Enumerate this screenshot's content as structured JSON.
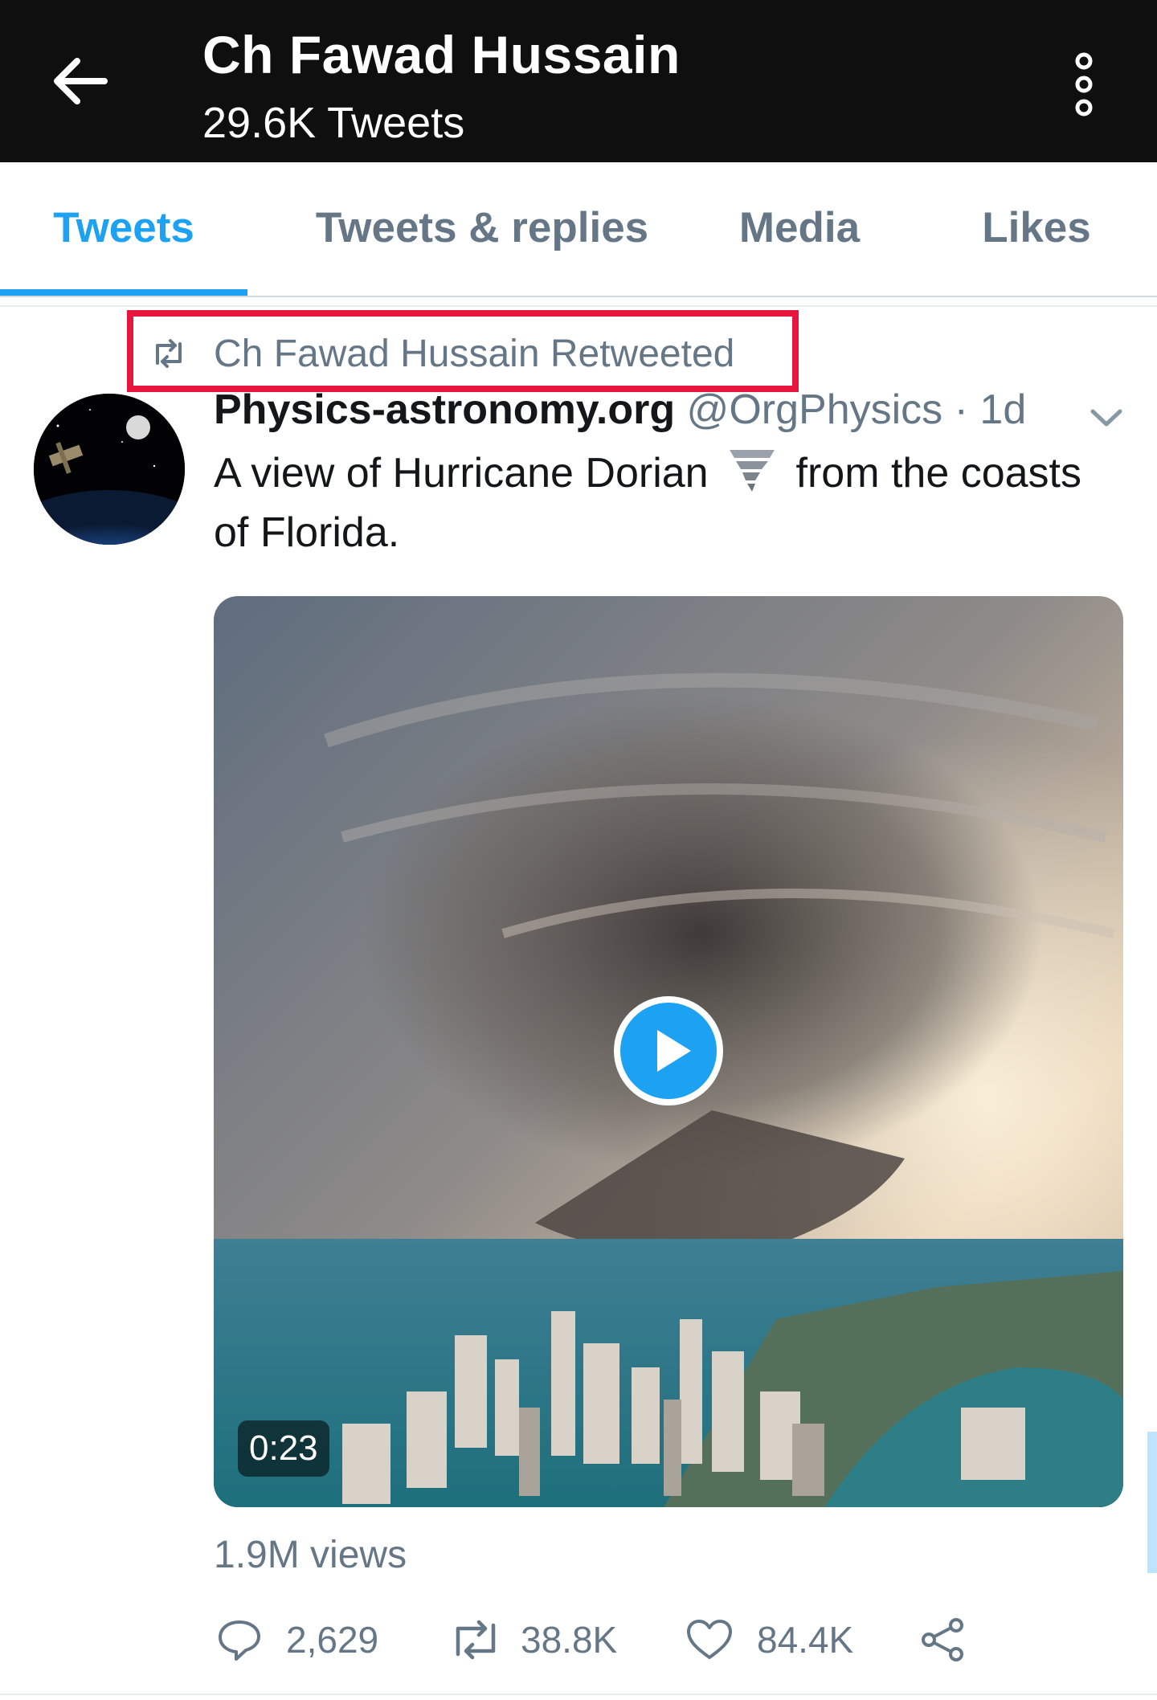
{
  "header": {
    "title": "Ch Fawad Hussain",
    "subtitle": "29.6K Tweets",
    "back_icon": "arrow-left-icon",
    "more_icon": "more-vertical-icon"
  },
  "tabs": [
    {
      "label": "Tweets",
      "active": true
    },
    {
      "label": "Tweets & replies",
      "active": false
    },
    {
      "label": "Media",
      "active": false
    },
    {
      "label": "Likes",
      "active": false
    }
  ],
  "tweet": {
    "retweet_label": "Ch Fawad Hussain Retweeted",
    "display_name": "Physics-astronomy.org",
    "handle": "@OrgPhysics",
    "separator": " · ",
    "time": "1d",
    "text_before": "A view of Hurricane Dorian",
    "text_after": "from the coasts of Florida.",
    "video_duration": "0:23",
    "views": "1.9M views",
    "actions": {
      "reply_count": "2,629",
      "retweet_count": "38.8K",
      "like_count": "84.4K"
    }
  },
  "colors": {
    "accent": "#1da1f2",
    "header_bg": "#0f0f10",
    "muted_text": "#657786",
    "highlight": "#e8163f"
  }
}
